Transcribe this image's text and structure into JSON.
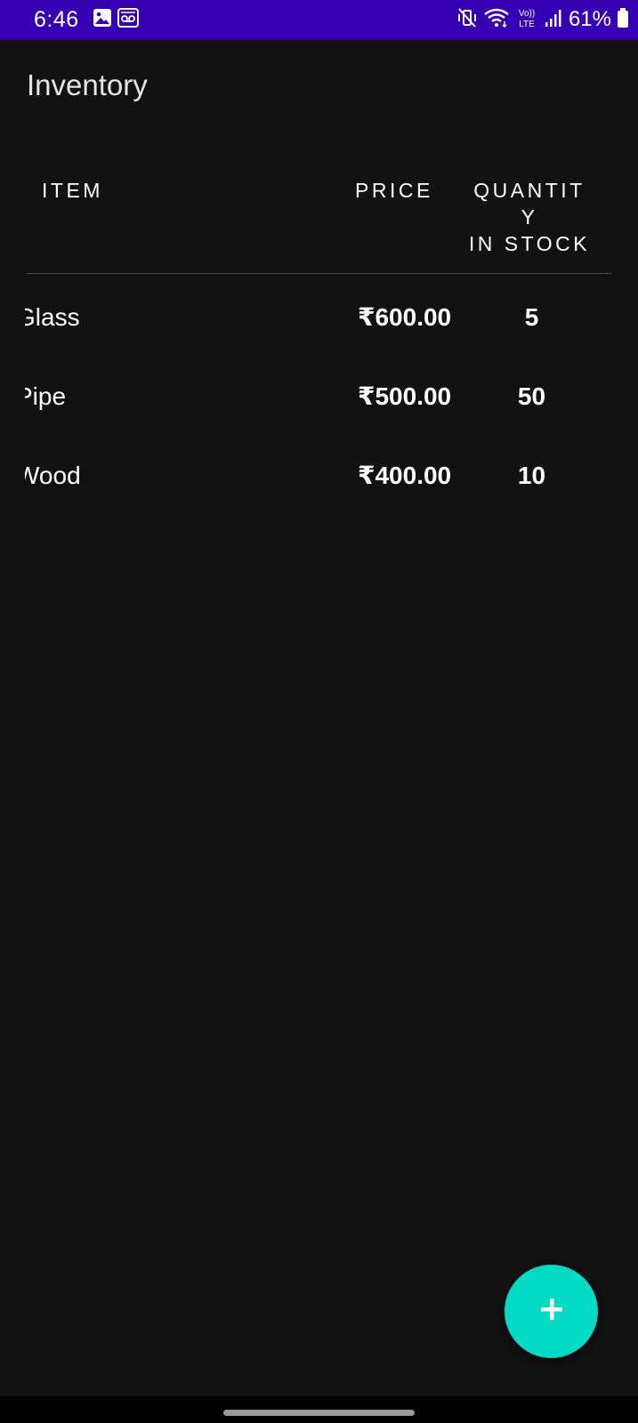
{
  "status_bar": {
    "time": "6:46",
    "battery": "61%",
    "background_color": "#3700b3",
    "icons_left": [
      "gallery-icon",
      "voicemail-icon"
    ],
    "icons_right": [
      "mute-vibrate-icon",
      "wifi-icon",
      "volte-icon",
      "signal-icon",
      "battery-icon"
    ]
  },
  "app": {
    "title": "Inventory"
  },
  "table": {
    "headers": {
      "item": "ITEM",
      "price": "PRICE",
      "quantity": "QUANTIT\nY\nIN STOCK"
    },
    "rows": [
      {
        "item": "Glass",
        "price": "₹600.00",
        "quantity": "5"
      },
      {
        "item": "Pipe",
        "price": "₹500.00",
        "quantity": "50"
      },
      {
        "item": "Wood",
        "price": "₹400.00",
        "quantity": "10"
      }
    ]
  },
  "fab": {
    "label": "+",
    "color": "#03dac5",
    "icon": "add-icon"
  }
}
